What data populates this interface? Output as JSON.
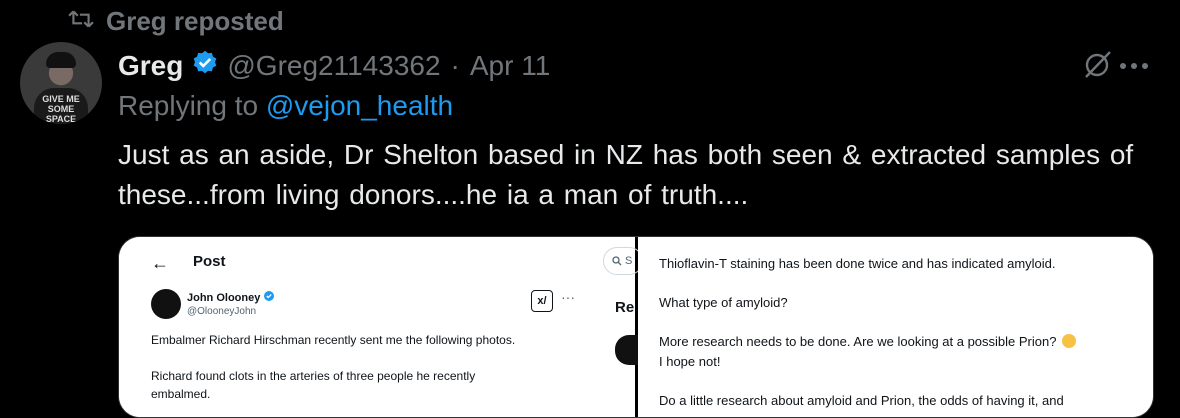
{
  "repost": {
    "label": "Greg reposted",
    "icon": "repost-icon"
  },
  "tweet": {
    "author_name": "Greg",
    "verified": true,
    "handle": "@Greg21143362",
    "separator": "·",
    "date": "Apr 11",
    "replying_prefix": "Replying to ",
    "replying_to": "@vejon_health",
    "text": "Just as an aside, Dr Shelton based in NZ has both seen & extracted samples of these...from  living  donors....he  ia  a  man  of  truth....",
    "avatar_text": "GIVE ME SOME SPACE"
  },
  "media": {
    "left": {
      "back": "←",
      "title": "Post",
      "search_placeholder": "S",
      "side_heading": "Re",
      "inner_author": "John Olooney",
      "inner_handle": "@OlooneyJohn",
      "grok": "x/",
      "more": "···",
      "para1": "Embalmer Richard Hirschman recently sent me the following photos.",
      "para2": "Richard found clots in the arteries of three people he recently embalmed."
    },
    "right": {
      "p1": "Thioflavin-T staining has been done twice and has indicated amyloid.",
      "p2": "What type of amyloid?",
      "p3a": "More research needs to be done. Are we looking at a possible Prion?",
      "p3b": "I hope not!",
      "p4": "Do a little research about amyloid and Prion, the odds of having it, and"
    }
  },
  "colors": {
    "background": "#000000",
    "accent": "#1d9bf0",
    "muted": "#71767b"
  }
}
